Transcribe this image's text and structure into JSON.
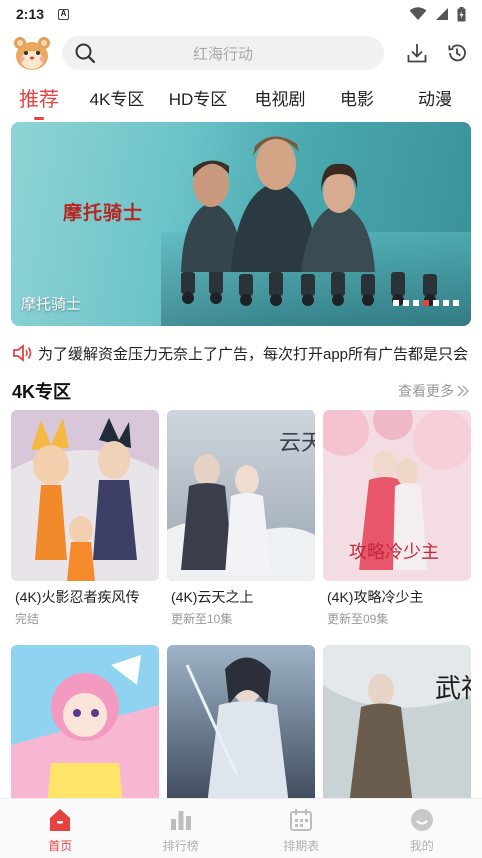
{
  "status_bar": {
    "time": "2:13",
    "notification_letter": "A"
  },
  "search": {
    "placeholder": "红海行动"
  },
  "tabs": [
    {
      "label": "推荐",
      "active": true
    },
    {
      "label": "4K专区",
      "active": false
    },
    {
      "label": "HD专区",
      "active": false
    },
    {
      "label": "电视剧",
      "active": false
    },
    {
      "label": "电影",
      "active": false
    },
    {
      "label": "动漫",
      "active": false
    }
  ],
  "banner": {
    "art_title": "摩托骑士",
    "caption": "摩托骑士",
    "dot_count": 7,
    "active_dot_index": 3
  },
  "notice": {
    "text": "为了缓解资金压力无奈上了广告，每次打开app所有广告都是只会"
  },
  "section": {
    "title": "4K专区",
    "more_label": "查看更多"
  },
  "cards": [
    {
      "title": "(4K)火影忍者疾风传",
      "subtitle": "完结"
    },
    {
      "title": "(4K)云天之上",
      "subtitle": "更新至10集"
    },
    {
      "title": "(4K)攻略冷少主",
      "subtitle": "更新至09集"
    },
    {
      "title": "",
      "subtitle": ""
    },
    {
      "title": "",
      "subtitle": ""
    },
    {
      "title": "",
      "subtitle": ""
    }
  ],
  "poster_art": {
    "card2_text": "云天之上",
    "card3_text": "攻略冷少主",
    "card6_text": "武神主宰"
  },
  "bottom_nav": [
    {
      "label": "首页",
      "active": true
    },
    {
      "label": "排行榜",
      "active": false
    },
    {
      "label": "排期表",
      "active": false
    },
    {
      "label": "我的",
      "active": false
    }
  ],
  "colors": {
    "accent": "#e64340",
    "muted": "#b0b0b0"
  }
}
